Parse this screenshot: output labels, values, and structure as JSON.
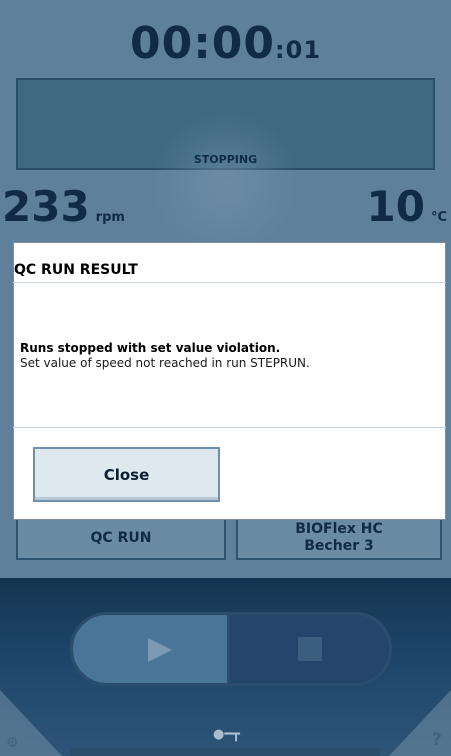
{
  "timer": {
    "main": "00:00",
    "seconds": ":01"
  },
  "status": "STOPPING",
  "speed": {
    "value": "233",
    "unit": "rpm"
  },
  "temperature": {
    "value": "10",
    "unit": "°C"
  },
  "programs": [
    {
      "label": "QC RUN"
    },
    {
      "label": "BIOFlex HC Becher 3"
    }
  ],
  "dialog": {
    "title": "QC RUN RESULT",
    "message_bold": "Runs stopped with set value violation.",
    "message": "Set value of speed not reached in run STEPRUN.",
    "close_label": "Close"
  },
  "icons": {
    "play": "play-icon",
    "stop": "stop-icon",
    "key": "key-icon",
    "settings": "gear-icon",
    "help": "help-icon"
  },
  "colors": {
    "background": "#5e809b",
    "dark_text": "#0f2b45",
    "bottom_panel": "#1c4466"
  }
}
